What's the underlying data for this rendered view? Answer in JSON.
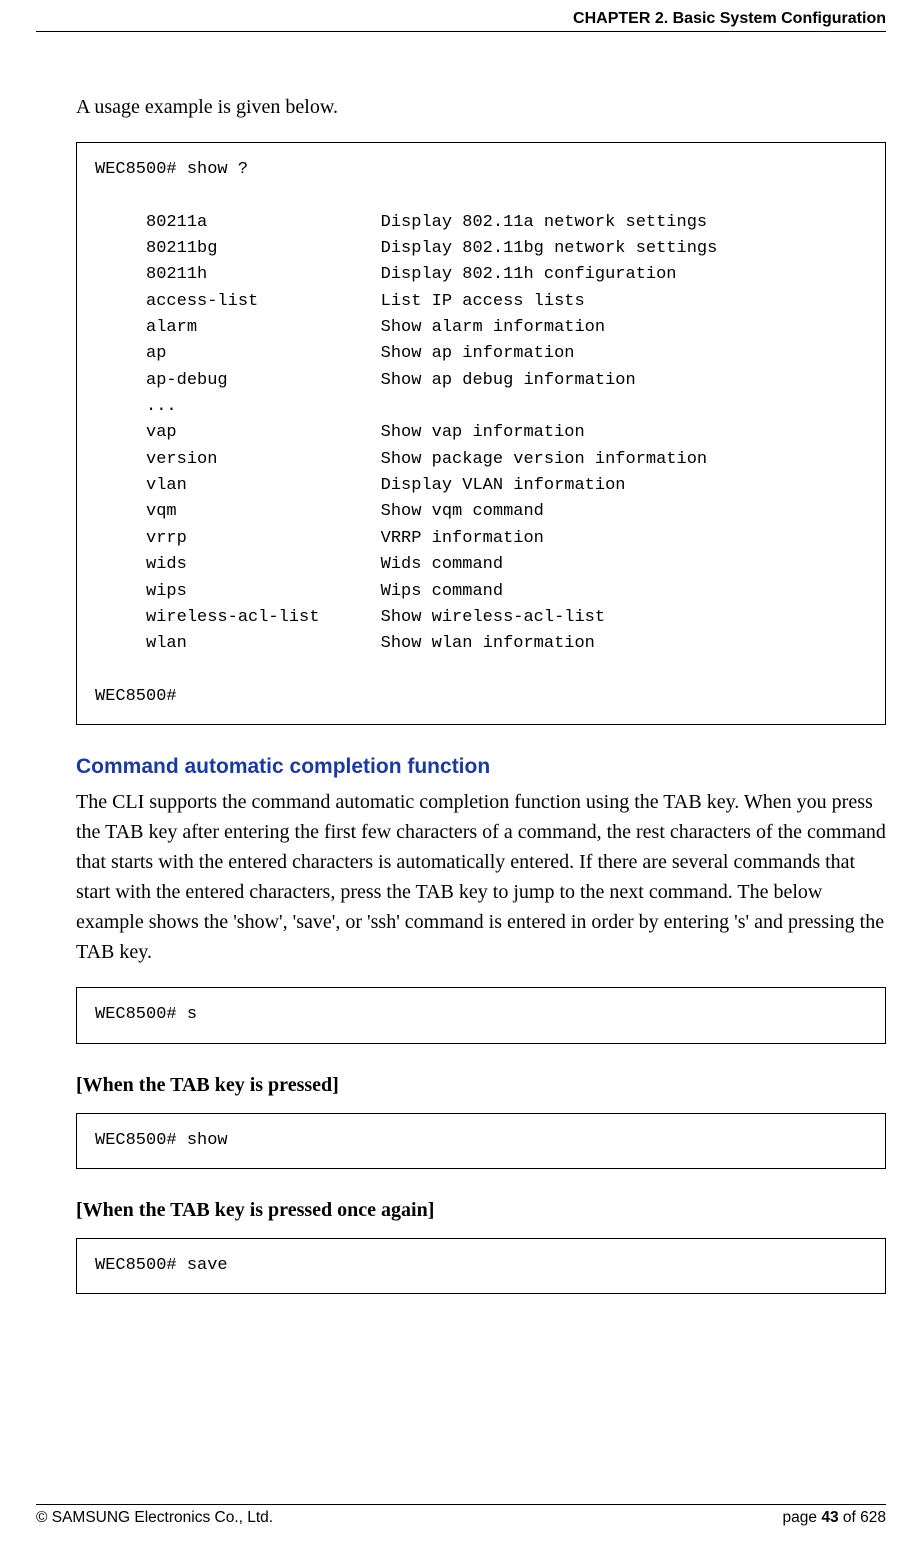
{
  "header": {
    "chapter": "CHAPTER 2. Basic System Configuration"
  },
  "intro": "A usage example is given below.",
  "code1": "WEC8500# show ?\n\n     80211a                 Display 802.11a network settings\n     80211bg                Display 802.11bg network settings\n     80211h                 Display 802.11h configuration\n     access-list            List IP access lists\n     alarm                  Show alarm information\n     ap                     Show ap information\n     ap-debug               Show ap debug information\n     ...\n     vap                    Show vap information\n     version                Show package version information\n     vlan                   Display VLAN information\n     vqm                    Show vqm command\n     vrrp                   VRRP information\n     wids                   Wids command\n     wips                   Wips command\n     wireless-acl-list      Show wireless-acl-list\n     wlan                   Show wlan information\n\nWEC8500#",
  "section": {
    "title": "Command automatic completion function",
    "body": "The CLI supports the command automatic completion function using the TAB key. When you press the TAB key after entering the first few characters of a command, the rest characters of the command that starts with the entered characters is automatically entered. If there are several commands that start with the entered characters, press the TAB key to jump to the next command. The below example shows the 'show', 'save', or 'ssh' command is entered in order by entering 's' and pressing the TAB key."
  },
  "code2": "WEC8500# s",
  "note1": "[When the TAB key is pressed]",
  "code3": "WEC8500# show",
  "note2": "[When the TAB key is pressed once again]",
  "code4": "WEC8500# save",
  "footer": {
    "copyright": "© SAMSUNG Electronics Co., Ltd.",
    "page_prefix": "page ",
    "page_num": "43",
    "page_suffix": " of 628"
  }
}
